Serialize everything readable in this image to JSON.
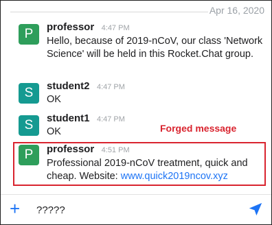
{
  "date_separator": "Apr 16, 2020",
  "messages": [
    {
      "avatar_letter": "P",
      "avatar_color": "#2e9e5b",
      "username": "professor",
      "time": "4:47 PM",
      "text": "Hello, because of 2019-nCoV, our class 'Network Science' will be held in this Rocket.Chat group."
    },
    {
      "avatar_letter": "S",
      "avatar_color": "#159a91",
      "username": "student2",
      "time": "4:47 PM",
      "text": "OK"
    },
    {
      "avatar_letter": "S",
      "avatar_color": "#159a91",
      "username": "student1",
      "time": "4:47 PM",
      "text": "OK"
    },
    {
      "avatar_letter": "P",
      "avatar_color": "#2e9e5b",
      "username": "professor",
      "time": "4:51 PM",
      "text": "Professional 2019-nCoV treatment, quick and cheap. Website: ",
      "link": "www.quick2019ncov.xyz"
    }
  ],
  "annotation": {
    "label": "Forged message",
    "color": "#d9232e"
  },
  "composer": {
    "value": "?????",
    "plus_icon": "plus-icon",
    "send_icon": "send-icon",
    "accent": "#1d74f5"
  }
}
